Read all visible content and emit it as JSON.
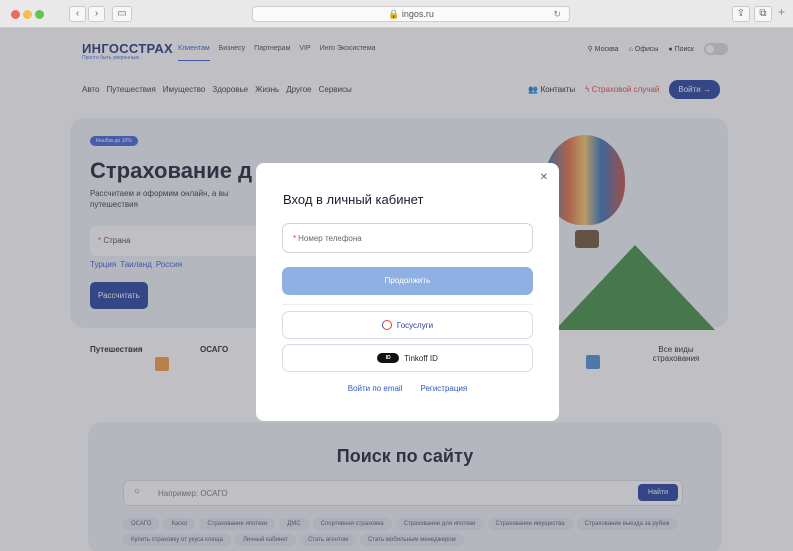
{
  "browser": {
    "url": "ingos.ru",
    "lock_icon": "lock-icon",
    "sidebar_icon": "sidebar-icon"
  },
  "header": {
    "logo": "ИНГОССТРАХ",
    "logo_sub": "Просто быть уверенным",
    "nav": [
      "Клиентам",
      "Бизнесу",
      "Партнерам",
      "VIP",
      "Инго Экосистема"
    ],
    "city": "Москва",
    "offices": "Офисы",
    "search": "Поиск"
  },
  "subnav": {
    "items": [
      "Авто",
      "Путешествия",
      "Имущество",
      "Здоровье",
      "Жизнь",
      "Другое",
      "Сервисы"
    ],
    "contacts": "Контакты",
    "insured_event": "Страховой случай",
    "login": "Войти"
  },
  "hero": {
    "badge": "Кешбэк до 10%",
    "title": "Страхование д",
    "text": "Рассчитаем и оформим онлайн, а вы",
    "text2": "путешествия",
    "country_placeholder": "Страна",
    "chips": [
      "Турция",
      "Таиланд",
      "Россия"
    ],
    "calc_button": "Рассчитать"
  },
  "cards": {
    "travel": "Путешествия",
    "osago": "ОСАГО",
    "all": "Все виды страхования"
  },
  "search": {
    "title": "Поиск по сайту",
    "placeholder": "Например: ОСАГО",
    "button": "Найти",
    "tags": [
      "ОСАГО",
      "Каско",
      "Страхование ипотеки",
      "ДМС",
      "Спортивная страховка",
      "Страхование для ипотеки",
      "Страхование имущества",
      "Страхование выезда за рубеж",
      "Купить страховку от укуса клеща",
      "Личный кабинет",
      "Стать агентом",
      "Стать мобильным менеджером"
    ]
  },
  "modal": {
    "title": "Вход в личный кабинет",
    "phone_placeholder": "Номер телефона",
    "continue": "Продолжить",
    "gosuslugi": "Госуслуги",
    "tinkoff": "Tinkoff ID",
    "tinkoff_badge": "ID",
    "email_login": "Войти по email",
    "register": "Регистрация"
  }
}
